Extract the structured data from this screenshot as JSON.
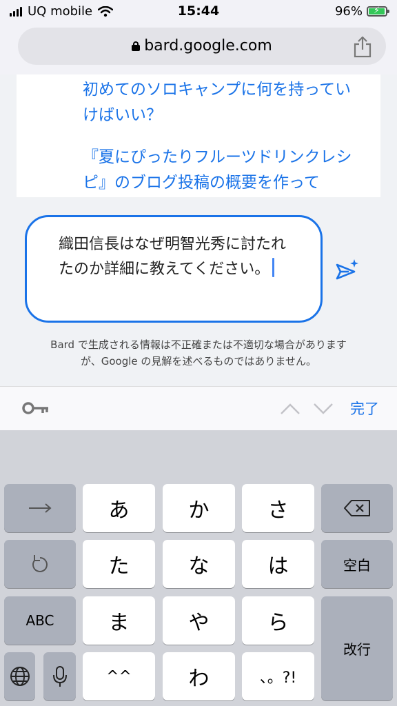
{
  "status_bar": {
    "carrier": "UQ mobile",
    "time": "15:44",
    "battery": "96%",
    "battery_level": 0.96
  },
  "browser": {
    "url": "bard.google.com"
  },
  "suggestions": [
    "初めてのソロキャンプに何を持っていけばいい？",
    "『夏にぴったりフルーツドリンクレシピ』のブログ投稿の概要を作って"
  ],
  "prompt": {
    "text": "織田信長はなぜ明智光秀に討たれたのか詳細に教えてください。"
  },
  "disclaimer": {
    "line1": "Bard で生成される情報は不正確または不適切な場合があります",
    "line2": "が、Google の見解を述べるものではありません。"
  },
  "accessory": {
    "done_label": "完了"
  },
  "keyboard": {
    "row1": [
      "あ",
      "か",
      "さ"
    ],
    "row2": [
      "た",
      "な",
      "は"
    ],
    "row3": [
      "ま",
      "や",
      "ら"
    ],
    "row4": [
      "^^",
      "わ",
      "、。?!"
    ],
    "space_label": "空白",
    "abc_label": "ABC",
    "enter_label": "改行"
  },
  "colors": {
    "accent": "#1a73e8",
    "battery": "#34c759"
  }
}
